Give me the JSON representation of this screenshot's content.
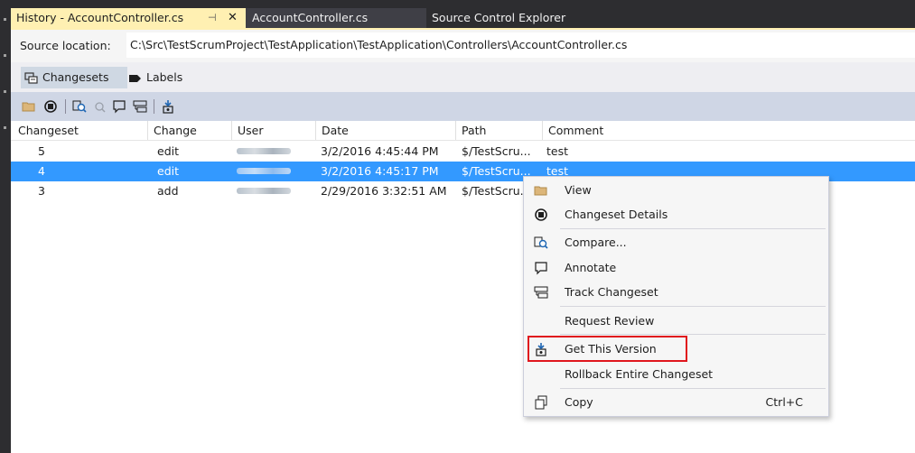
{
  "tabs": {
    "active_title": "History - AccountController.cs",
    "tab2": "AccountController.cs",
    "tab3": "Source Control Explorer"
  },
  "source": {
    "label": "Source location:",
    "path": "C:\\Src\\TestScrumProject\\TestApplication\\TestApplication\\Controllers\\AccountController.cs"
  },
  "subtabs": {
    "changesets": "Changesets",
    "labels": "Labels"
  },
  "toolbar": {
    "icons": [
      "view-icon",
      "changeset-details-icon",
      "compare-icon",
      "compare-disabled-icon",
      "annotate-icon",
      "track-changeset-icon",
      "get-this-version-icon"
    ]
  },
  "columns": [
    "Changeset",
    "Change",
    "User",
    "Date",
    "Path",
    "Comment"
  ],
  "rows": [
    {
      "changeset": "5",
      "change": "edit",
      "date": "3/2/2016 4:45:44 PM",
      "path": "$/TestScru...",
      "comment": "test"
    },
    {
      "changeset": "4",
      "change": "edit",
      "date": "3/2/2016 4:45:17 PM",
      "path": "$/TestScru...",
      "comment": "test"
    },
    {
      "changeset": "3",
      "change": "add",
      "date": "2/29/2016 3:32:51 AM",
      "path": "$/TestScru...",
      "comment": ""
    }
  ],
  "selected_row": "4",
  "context_menu": {
    "items": [
      {
        "label": "View",
        "icon": "folder-open-icon"
      },
      {
        "label": "Changeset Details",
        "icon": "changeset-details-icon"
      },
      {
        "label": "Compare...",
        "icon": "compare-icon"
      },
      {
        "label": "Annotate",
        "icon": "annotate-icon"
      },
      {
        "label": "Track Changeset",
        "icon": "track-changeset-icon"
      },
      {
        "label": "Request Review",
        "icon": ""
      },
      {
        "label": "Get This Version",
        "icon": "get-this-version-icon"
      },
      {
        "label": "Rollback Entire Changeset",
        "icon": ""
      },
      {
        "label": "Copy",
        "icon": "copy-icon",
        "shortcut": "Ctrl+C"
      }
    ]
  },
  "colors": {
    "active_tab": "#fff0b2",
    "selection": "#3399ff",
    "highlight_border": "#e0161d",
    "chrome_dark": "#2d2d30"
  }
}
